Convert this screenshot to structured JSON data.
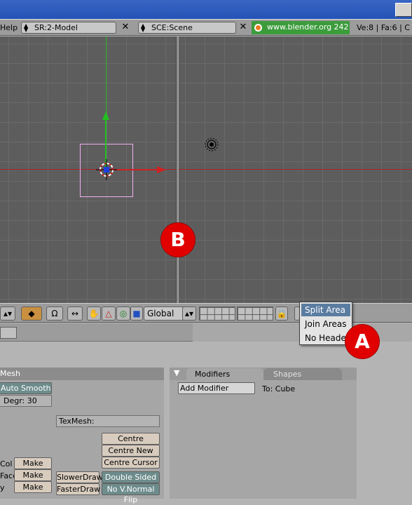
{
  "info_header": {
    "help_menu": "Help",
    "screen": "SR:2-Model",
    "scene": "SCE:Scene",
    "url": "www.blender.org 242",
    "stats": "Ve:8 | Fa:6 | C"
  },
  "view3d_header": {
    "orientation": "Global"
  },
  "context_menu": {
    "items": [
      "Split Area",
      "Join Areas",
      "No Header"
    ],
    "selected_index": 0
  },
  "markers": {
    "a": "A",
    "b": "B"
  },
  "mesh_panel": {
    "title": "Mesh",
    "auto_smooth": "Auto Smooth",
    "degr": "Degr: 30",
    "texmesh": "TexMesh:",
    "col_label": "Col",
    "face_label": "Face",
    "y_label": "y",
    "make": "Make",
    "centre": "Centre",
    "centre_new": "Centre New",
    "centre_cursor": "Centre Cursor",
    "slower_draw": "SlowerDraw",
    "faster_draw": "FasterDraw",
    "double_sided": "Double Sided",
    "no_vnormal_flip": "No V.Normal Flip"
  },
  "modifiers_panel": {
    "tab_modifiers": "Modifiers",
    "tab_shapes": "Shapes",
    "add_modifier": "Add Modifier",
    "to_label": "To: Cube"
  },
  "colors": {
    "accent_menu_selected": "#5a7ca0",
    "url_green": "#3c9c3c",
    "marker_red": "#e00000",
    "viewport_bg": "#5d5d5d"
  }
}
